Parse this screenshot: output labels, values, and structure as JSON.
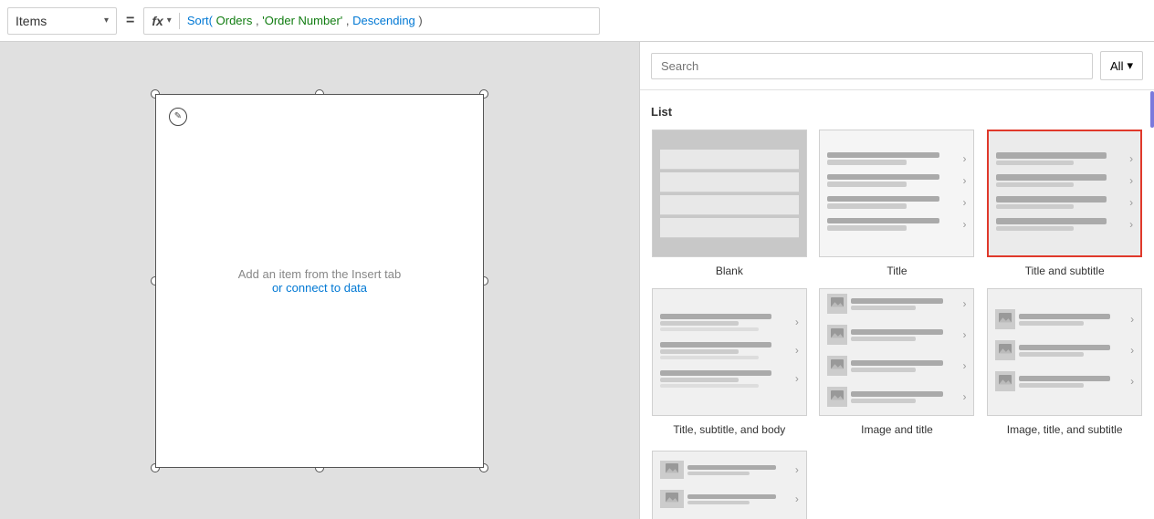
{
  "toolbar": {
    "items_label": "Items",
    "equals_symbol": "=",
    "fx_label": "fx",
    "formula_text": "Sort( Orders, 'Order Number', Descending )",
    "formula_parts": {
      "keyword1": "Sort(",
      "arg1": " Orders, ",
      "arg2": "'Order Number'",
      "sep": ", ",
      "arg3": "Descending",
      "close": " )"
    }
  },
  "search": {
    "placeholder": "Search",
    "filter_label": "All"
  },
  "panel": {
    "section_label": "List",
    "templates": [
      {
        "id": "blank",
        "label": "Blank",
        "selected": false
      },
      {
        "id": "title",
        "label": "Title",
        "selected": false
      },
      {
        "id": "title-subtitle",
        "label": "Title and subtitle",
        "selected": true
      },
      {
        "id": "title-subtitle-body",
        "label": "Title, subtitle, and body",
        "selected": false
      },
      {
        "id": "image-title",
        "label": "Image and title",
        "selected": false
      },
      {
        "id": "image-title-subtitle",
        "label": "Image, title, and subtitle",
        "selected": false
      }
    ]
  },
  "canvas": {
    "message_text": "Add an item from the Insert tab",
    "message_link": "or connect to data"
  }
}
